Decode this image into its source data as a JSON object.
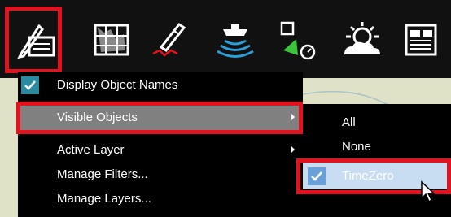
{
  "toolbar": {
    "buttons": [
      {
        "icon": "object-edit-icon"
      },
      {
        "icon": "chart-tiles-icon"
      },
      {
        "icon": "route-pen-icon"
      },
      {
        "icon": "sonar-boat-icon"
      },
      {
        "icon": "target-select-icon"
      },
      {
        "icon": "weather-sun-cloud-icon"
      },
      {
        "icon": "data-panel-icon"
      }
    ]
  },
  "menu": {
    "items": [
      {
        "label": "Display Object Names",
        "checked": true
      },
      {
        "label": "Visible Objects",
        "submenu": true,
        "highlighted": true
      },
      {
        "label": "Active Layer",
        "submenu": true
      },
      {
        "label": "Manage Filters..."
      },
      {
        "label": "Manage Layers..."
      }
    ]
  },
  "submenu": {
    "items": [
      {
        "label": "All"
      },
      {
        "label": "None"
      },
      {
        "label": "TimeZero",
        "checked": true,
        "highlighted": true
      }
    ]
  },
  "colors": {
    "highlight_frame": "#e3121f",
    "menu_background": "#000000",
    "menu_selection": "#808080",
    "submenu_selection": "#c8dcf2",
    "check_teal": "#2a8aa0"
  }
}
